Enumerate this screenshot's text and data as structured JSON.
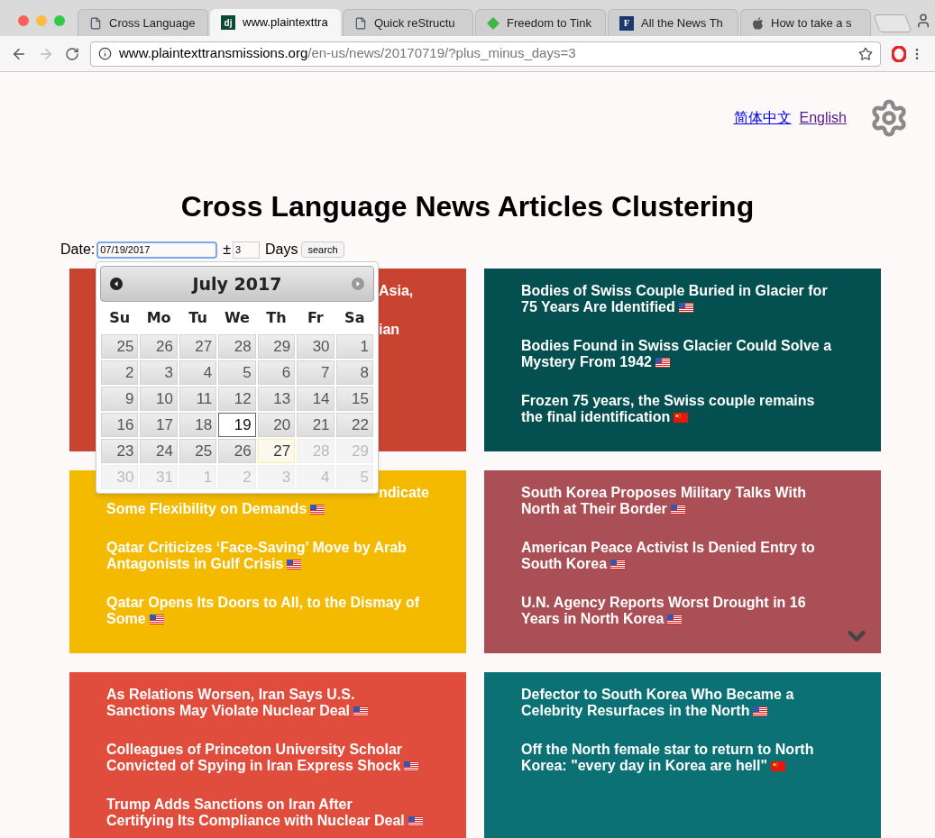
{
  "browser": {
    "tabs": [
      {
        "title": "Cross Language",
        "kind": "page",
        "selected": false
      },
      {
        "title": "www.plaintexttra",
        "kind": "dj",
        "selected": true
      },
      {
        "title": "Quick reStructu",
        "kind": "page",
        "selected": false
      },
      {
        "title": "Freedom to Tink",
        "kind": "diamond",
        "selected": false
      },
      {
        "title": "All the News Th",
        "kind": "f",
        "selected": false
      },
      {
        "title": "How to take a s",
        "kind": "apple",
        "selected": false
      }
    ],
    "favicon_text": {
      "dj": "dj",
      "f": "F"
    },
    "address": {
      "host": "www.plaintexttransmissions.org",
      "path": "/en-us/news/20170719/?plus_minus_days=3"
    }
  },
  "language_links": [
    {
      "label": "简体中文",
      "visited": false
    },
    {
      "label": "English",
      "visited": true
    }
  ],
  "title": "Cross Language News Articles Clustering",
  "search_form": {
    "date_label": "Date:",
    "date_value": "07/19/2017",
    "plus_minus": "±",
    "days_value": "3",
    "days_label": "Days",
    "button": "search"
  },
  "datepicker": {
    "month": "July 2017",
    "weekdays": [
      "Su",
      "Mo",
      "Tu",
      "We",
      "Th",
      "Fr",
      "Sa"
    ],
    "weeks": [
      [
        {
          "day": "25",
          "disabled": false,
          "selected": false,
          "today": false
        },
        {
          "day": "26",
          "disabled": false,
          "selected": false,
          "today": false
        },
        {
          "day": "27",
          "disabled": false,
          "selected": false,
          "today": false
        },
        {
          "day": "28",
          "disabled": false,
          "selected": false,
          "today": false
        },
        {
          "day": "29",
          "disabled": false,
          "selected": false,
          "today": false
        },
        {
          "day": "30",
          "disabled": false,
          "selected": false,
          "today": false
        },
        {
          "day": "1",
          "disabled": false,
          "selected": false,
          "today": false
        }
      ],
      [
        {
          "day": "2",
          "disabled": false,
          "selected": false,
          "today": false
        },
        {
          "day": "3",
          "disabled": false,
          "selected": false,
          "today": false
        },
        {
          "day": "4",
          "disabled": false,
          "selected": false,
          "today": false
        },
        {
          "day": "5",
          "disabled": false,
          "selected": false,
          "today": false
        },
        {
          "day": "6",
          "disabled": false,
          "selected": false,
          "today": false
        },
        {
          "day": "7",
          "disabled": false,
          "selected": false,
          "today": false
        },
        {
          "day": "8",
          "disabled": false,
          "selected": false,
          "today": false
        }
      ],
      [
        {
          "day": "9",
          "disabled": false,
          "selected": false,
          "today": false
        },
        {
          "day": "10",
          "disabled": false,
          "selected": false,
          "today": false
        },
        {
          "day": "11",
          "disabled": false,
          "selected": false,
          "today": false
        },
        {
          "day": "12",
          "disabled": false,
          "selected": false,
          "today": false
        },
        {
          "day": "13",
          "disabled": false,
          "selected": false,
          "today": false
        },
        {
          "day": "14",
          "disabled": false,
          "selected": false,
          "today": false
        },
        {
          "day": "15",
          "disabled": false,
          "selected": false,
          "today": false
        }
      ],
      [
        {
          "day": "16",
          "disabled": false,
          "selected": false,
          "today": false
        },
        {
          "day": "17",
          "disabled": false,
          "selected": false,
          "today": false
        },
        {
          "day": "18",
          "disabled": false,
          "selected": false,
          "today": false
        },
        {
          "day": "19",
          "disabled": false,
          "selected": true,
          "today": false
        },
        {
          "day": "20",
          "disabled": false,
          "selected": false,
          "today": false
        },
        {
          "day": "21",
          "disabled": false,
          "selected": false,
          "today": false
        },
        {
          "day": "22",
          "disabled": false,
          "selected": false,
          "today": false
        }
      ],
      [
        {
          "day": "23",
          "disabled": false,
          "selected": false,
          "today": false
        },
        {
          "day": "24",
          "disabled": false,
          "selected": false,
          "today": false
        },
        {
          "day": "25",
          "disabled": false,
          "selected": false,
          "today": false
        },
        {
          "day": "26",
          "disabled": false,
          "selected": false,
          "today": false
        },
        {
          "day": "27",
          "disabled": false,
          "selected": false,
          "today": true
        },
        {
          "day": "28",
          "disabled": true,
          "selected": false,
          "today": false
        },
        {
          "day": "29",
          "disabled": true,
          "selected": false,
          "today": false
        }
      ],
      [
        {
          "day": "30",
          "disabled": true,
          "selected": false,
          "today": false
        },
        {
          "day": "31",
          "disabled": true,
          "selected": false,
          "today": false
        },
        {
          "day": "1",
          "disabled": true,
          "selected": false,
          "today": false
        },
        {
          "day": "2",
          "disabled": true,
          "selected": false,
          "today": false
        },
        {
          "day": "3",
          "disabled": true,
          "selected": false,
          "today": false
        },
        {
          "day": "4",
          "disabled": true,
          "selected": false,
          "today": false
        },
        {
          "day": "5",
          "disabled": true,
          "selected": false,
          "today": false
        }
      ]
    ]
  },
  "clusters": [
    {
      "color": "#c84431",
      "more": false,
      "articles": [
        {
          "partial_line": "Asia,"
        },
        {
          "partial_line": "ian"
        }
      ]
    },
    {
      "color": "#044f4f",
      "more": false,
      "articles": [
        {
          "title": "Bodies of Swiss Couple Buried in Glacier for 75 Years Are Identified",
          "kind": "english"
        },
        {
          "title": "Bodies Found in Swiss Glacier Could Solve a Mystery From 1942",
          "kind": "english"
        },
        {
          "title": "Frozen 75 years, the Swiss couple remains the final identification",
          "kind": "chinese"
        }
      ]
    },
    {
      "color": "#f4ba00",
      "more": false,
      "articles": [
        {
          "partial_line": "ndicate",
          "title": "Some Flexibility on Demands",
          "kind": "english"
        },
        {
          "title": "Qatar Criticizes ‘Face-Saving’ Move by Arab Antagonists in Gulf Crisis",
          "kind": "english"
        },
        {
          "title": "Qatar Opens Its Doors to All, to the Dismay of Some",
          "kind": "english"
        }
      ]
    },
    {
      "color": "#ab4f57",
      "more": true,
      "articles": [
        {
          "title": "South Korea Proposes Military Talks With North at Their Border",
          "kind": "english"
        },
        {
          "title": "American Peace Activist Is Denied Entry to South Korea",
          "kind": "english"
        },
        {
          "title": "U.N. Agency Reports Worst Drought in 16 Years in North Korea",
          "kind": "english"
        }
      ]
    },
    {
      "color": "#e04d3c",
      "more": false,
      "articles": [
        {
          "title": "As Relations Worsen, Iran Says U.S. Sanctions May Violate Nuclear Deal",
          "kind": "english"
        },
        {
          "title": "Colleagues of Princeton University Scholar Convicted of Spying in Iran Express Shock",
          "kind": "english"
        },
        {
          "title": "Trump Adds Sanctions on Iran After Certifying Its Compliance with Nuclear Deal",
          "kind": "english"
        }
      ]
    },
    {
      "color": "#0b7175",
      "more": false,
      "articles": [
        {
          "title": "Defector to South Korea Who Became a Celebrity Resurfaces in the North",
          "kind": "english"
        },
        {
          "title": "Off the North female star to return to North Korea: \"every day in Korea are hell\"",
          "kind": "chinese"
        }
      ]
    }
  ]
}
